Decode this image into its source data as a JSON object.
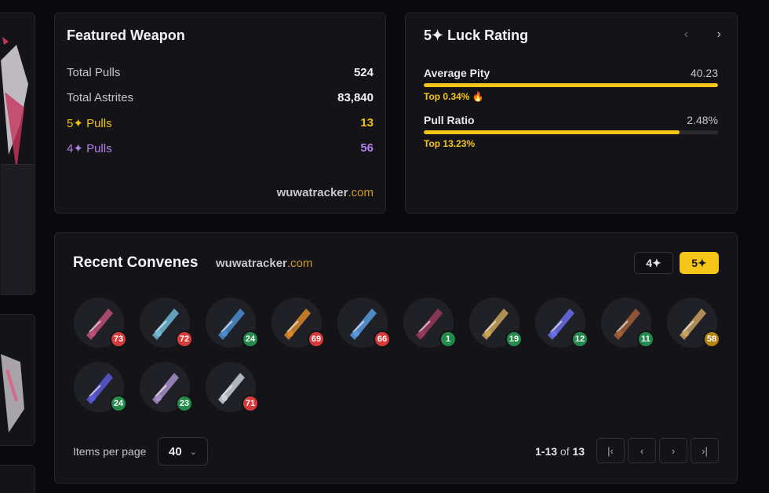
{
  "featured_weapon": {
    "title": "Featured Weapon",
    "stats": [
      {
        "label": "Total Pulls",
        "value": "524"
      },
      {
        "label": "Total Astrites",
        "value": "83,840"
      },
      {
        "label": "5✦ Pulls",
        "value": "13"
      },
      {
        "label": "4✦ Pulls",
        "value": "56"
      }
    ],
    "brand_name": "wuwatracker",
    "brand_domain": ".com"
  },
  "luck_rating": {
    "title": "5✦ Luck Rating",
    "prev_icon": "chevron-left-icon",
    "next_icon": "chevron-right-icon",
    "metrics": [
      {
        "name": "Average Pity",
        "value": "40.23",
        "top": "Top 0.34% 🔥",
        "fill_fraction": 1.0
      },
      {
        "name": "Pull Ratio",
        "value": "2.48%",
        "top": "Top 13.23%",
        "fill_fraction": 0.87
      }
    ],
    "accent": "#f5c518"
  },
  "recent_convenes": {
    "title": "Recent Convenes",
    "brand_name": "wuwatracker",
    "brand_domain": ".com",
    "toggle_4": "4✦",
    "toggle_5": "5✦",
    "items": [
      {
        "pity": "73",
        "status": "red"
      },
      {
        "pity": "72",
        "status": "red"
      },
      {
        "pity": "24",
        "status": "green"
      },
      {
        "pity": "69",
        "status": "red"
      },
      {
        "pity": "66",
        "status": "red"
      },
      {
        "pity": "1",
        "status": "green"
      },
      {
        "pity": "19",
        "status": "green"
      },
      {
        "pity": "12",
        "status": "green"
      },
      {
        "pity": "11",
        "status": "green"
      },
      {
        "pity": "58",
        "status": "gold"
      },
      {
        "pity": "24",
        "status": "green"
      },
      {
        "pity": "23",
        "status": "green"
      },
      {
        "pity": "71",
        "status": "red"
      }
    ],
    "items_per_page_label": "Items per page",
    "items_per_page_value": "40",
    "range_text": "1-13",
    "range_of": "of",
    "range_total": "13",
    "pagination_icons": [
      "first-page-icon",
      "prev-page-icon",
      "next-page-icon",
      "last-page-icon"
    ]
  }
}
